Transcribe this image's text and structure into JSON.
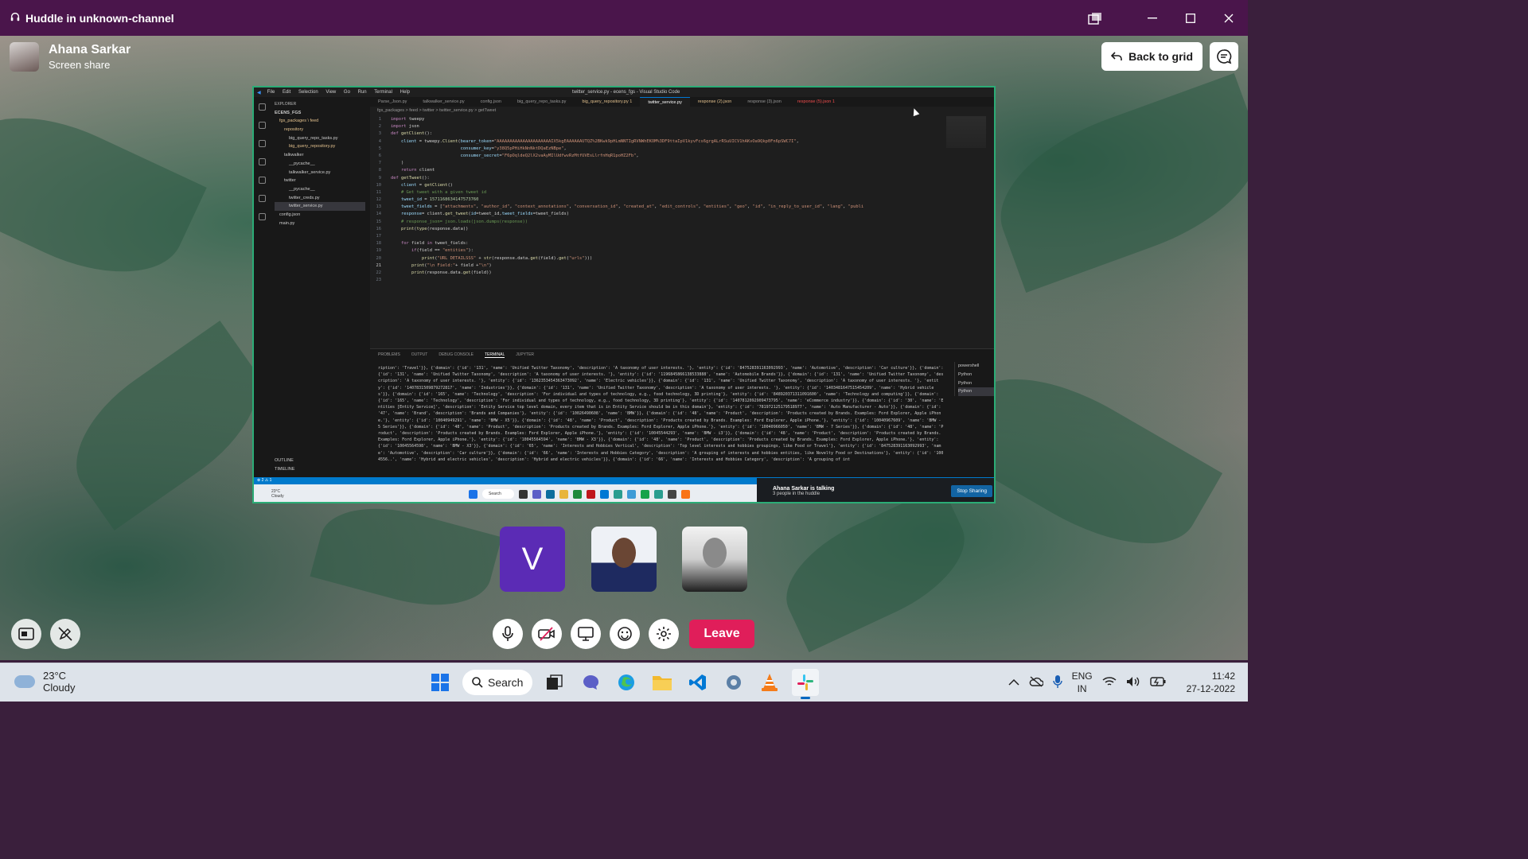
{
  "window": {
    "title": "Huddle in unknown-channel"
  },
  "presenter": {
    "name": "Ahana Sarkar",
    "status": "Screen share"
  },
  "back_to_grid_label": "Back to grid",
  "shared_screen": {
    "vscode": {
      "menu": [
        "File",
        "Edit",
        "Selection",
        "View",
        "Go",
        "Run",
        "Terminal",
        "Help"
      ],
      "window_title": "twitter_service.py - ecens_fgs - Visual Studio Code",
      "explorer_header": "EXPLORER",
      "explorer": [
        "ECENS_FGS",
        "fgs_packages \\ feed",
        "repository",
        "big_query_repo_tasks.py",
        "big_query_repository.py",
        "talkwalker",
        "__pycache__",
        "talkwalker_service.py",
        "twitter",
        "__pycache__",
        "twitter_creds.py",
        "twitter_service.py",
        "config.json",
        "main.py"
      ],
      "outline": [
        "OUTLINE",
        "TIMELINE"
      ],
      "tabs": [
        "Parse_Json.py",
        "talkwalker_service.py",
        "config.json",
        "big_query_repo_tasks.py",
        "big_query_repository.py 1",
        "twitter_service.py",
        "response (2).json",
        "response (3).json",
        "response (5).json 1"
      ],
      "breadcrumb": "fgs_packages > feed > twitter > twitter_service.py > getTweet",
      "panel_tabs": [
        "PROBLEMS",
        "OUTPUT",
        "DEBUG CONSOLE",
        "TERMINAL",
        "JUPYTER"
      ],
      "terminal_list": [
        "powershell",
        "Python",
        "Python",
        "Python"
      ],
      "status_left": "⊗ 2 ⚠ 1",
      "terminal_text": "ription': 'Travel'}}, {'domain': {'id': '131', 'name': 'Unified Twitter Taxonomy', 'description': 'A taxonomy of user interests. '}, 'entity': {'id': '847528391163092993', 'name': 'Automotive', 'description': 'Car culture'}}, {'domain': {'id': '131', 'name': 'Unified Twitter Taxonomy', 'description': 'A taxonomy of user interests. '}, 'entity': {'id': '1196845866138533888', 'name': 'Automobile Brands'}}, {'domain': {'id': '131', 'name': 'Unified Twitter Taxonomy', 'description': 'A taxonomy of user interests. '}, 'entity': {'id': '1362353454363473092', 'name': 'Electric vehicles'}}, {'domain': {'id': '131', 'name': 'Unified Twitter Taxonomy', 'description': 'A taxonomy of user interests. '}, 'entity': {'id': '1407831509879272817', 'name': 'Industries'}}, {'domain': {'id': '131', 'name': 'Unified Twitter Taxonomy', 'description': 'A taxonomy of user interests. '}, 'entity': {'id': '1403481647515454209', 'name': 'Hybrid vehicles'}}, {'domain': {'id': '165', 'name': 'Technology', 'description': 'For individual and types of technology, e.g., food technology, 3D printing'}, 'entity': {'id': '848920371311091600', 'name': 'Technology and computing'}}, {'domain': {'id': '165', 'name': 'Technology', 'description': 'For individual and types of technology, e.g., food technology, 3D printing'}, 'entity': {'id': '1407812092909473795', 'name': 'eCommerce industry'}}, {'domain': {'id': '30', 'name': 'Entities [Entity Service]', 'description': 'Entity Service top level domain, every item that is in Entity Service should be in this domain'}, 'entity': {'id': '781972125179518977', 'name': 'Auto Manufacturer - Auto'}}, {'domain': {'id': '47', 'name': 'Brand', 'description': 'Brands and Companies'}, 'entity': {'id': '10026490608', 'name': 'BMW'}}, {'domain': {'id': '48', 'name': 'Product', 'description': 'Products created by Brands. Examples: Ford Explorer, Apple iPhone.'}, 'entity': {'id': '10040949291', 'name': 'BMW - X5'}}, {'domain': {'id': '48', 'name': 'Product', 'description': 'Products created by Brands. Examples: Ford Explorer, Apple iPhone.'}, 'entity': {'id': '10040967609', 'name': 'BMW - 5 Series'}}, {'domain': {'id': '48', 'name': 'Product', 'description': 'Products created by Brands. Examples: Ford Explorer, Apple iPhone.'}, 'entity': {'id': '10040966050', 'name': 'BMW - 7 Series'}}, {'domain': {'id': '48', 'name': 'Product', 'description': 'Products created by Brands. Examples: Ford Explorer, Apple iPhone.'}, 'entity': {'id': '10045544293', 'name': 'BMW - i3'}}, {'domain': {'id': '48', 'name': 'Product', 'description': 'Products created by Brands. Examples: Ford Explorer, Apple iPhone.'}, 'entity': {'id': '10045564594', 'name': 'BMW - X3'}}, {'domain': {'id': '48', 'name': 'Product', 'description': 'Products created by Brands. Examples: Ford Explorer, Apple iPhone.'}, 'entity': {'id': '10045564598', 'name': 'BMW - X3'}}, {'domain': {'id': '65', 'name': 'Interests and Hobbies Vertical', 'description': 'Top level interests and hobbies groupings, like Food or Travel'}, 'entity': {'id': '847528391163092993', 'name': 'Automotive', 'description': 'Car culture'}}, {'domain': {'id': '66', 'name': 'Interests and Hobbies Category', 'description': 'A grouping of interests and hobbies entities, like Novelty Food or Destinations'}, 'entity': {'id': '1004556..', 'name': 'Hybrid and electric vehicles', 'description': 'Hybrid and electric vehicles'}}, {'domain': {'id': '66', 'name': 'Interests and Hobbies Category', 'description': 'A grouping of int"
    },
    "windows": {
      "temp": "23°C",
      "condition": "Cloudy",
      "search_label": "Search"
    },
    "mini_huddle": {
      "talking": "Ahana Sarkar is talking",
      "count": "3 people in the huddle",
      "stop": "Stop Sharing"
    }
  },
  "participants": [
    {
      "initial": "V",
      "color": "#5b2bb5"
    },
    {
      "kind": "photo"
    },
    {
      "kind": "photo"
    }
  ],
  "leave_label": "Leave",
  "taskbar": {
    "weather_temp": "23°C",
    "weather_condition": "Cloudy",
    "search_label": "Search",
    "lang": "ENG",
    "region": "IN",
    "time": "11:42",
    "date": "27-12-2022"
  }
}
